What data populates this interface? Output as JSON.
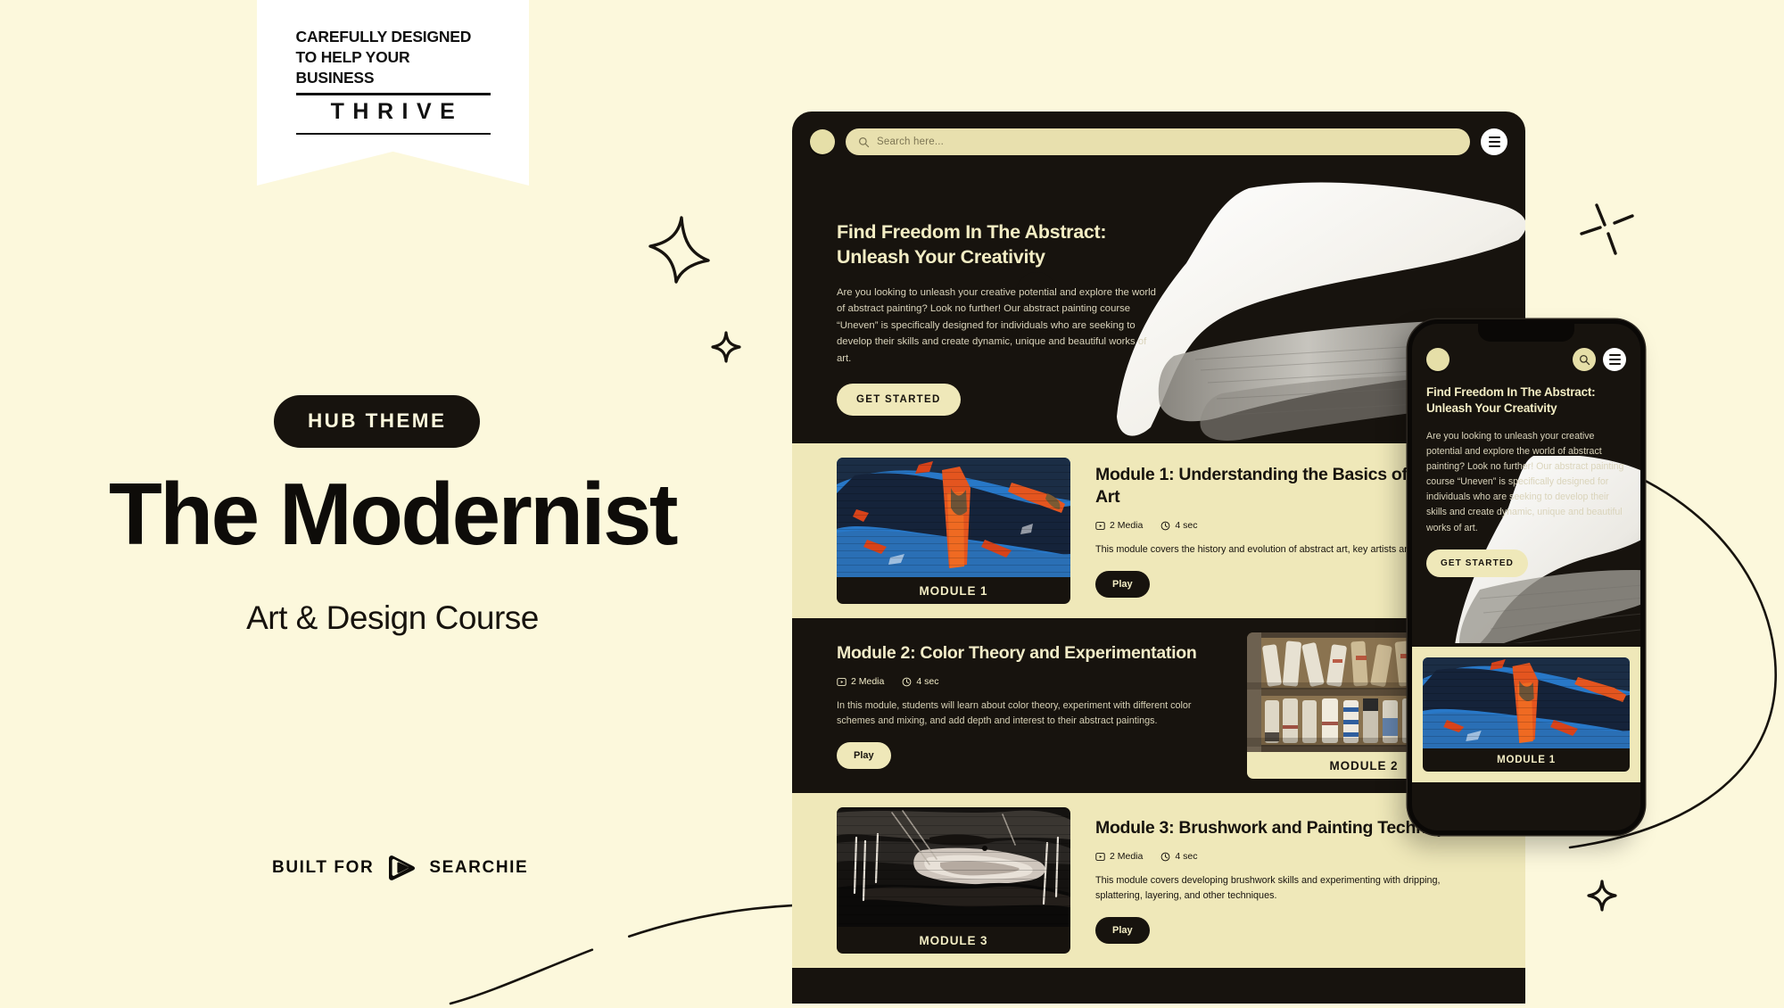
{
  "background_color": "#FCF8DC",
  "ribbon": {
    "line1": "CAREFULLY DESIGNED",
    "line2": "TO HELP YOUR BUSINESS",
    "word": "THRIVE"
  },
  "promo": {
    "badge": "HUB THEME",
    "title": "The Modernist",
    "subtitle": "Art & Design Course",
    "built_for_label": "BUILT FOR",
    "brand": "SEARCHIE",
    "brand_icon": "searchie-play-icon"
  },
  "desktop": {
    "logo_icon": "brand-circle-logo",
    "search": {
      "placeholder": "Search here...",
      "value": "",
      "icon": "search-icon"
    },
    "menu_icon": "hamburger-menu-icon",
    "hero": {
      "title": "Find Freedom In The Abstract: Unleash Your Creativity",
      "title_line1": "Find Freedom In The Abstract:",
      "title_line2": "Unleash Your Creativity",
      "body": "Are you looking to unleash your creative potential and explore the world of abstract painting? Look no further! Our abstract painting course “Uneven” is specifically designed for individuals who are seeking to develop their skills and create dynamic, unique and beautiful works of art.",
      "cta": "GET STARTED",
      "artwork_label": "uneven",
      "artwork_name": "white-brushstroke-artwork"
    },
    "modules": [
      {
        "card_label": "MODULE 1",
        "title": "Module 1: Understanding the Basics of Abstract Art",
        "media_count": "2 Media",
        "duration": "4 sec",
        "media_icon": "media-play-box-icon",
        "clock_icon": "clock-icon",
        "description": "This module covers the history and evolution of abstract art, key artists and techniques.",
        "play_label": "Play",
        "image_name": "blue-orange-abstract-painting",
        "theme": "cream"
      },
      {
        "card_label": "MODULE 2",
        "title": "Module 2: Color Theory and Experimentation",
        "media_count": "2 Media",
        "duration": "4 sec",
        "media_icon": "media-play-box-icon",
        "clock_icon": "clock-icon",
        "description": "In this module, students will learn about color theory, experiment with different color schemes and mixing, and add depth and interest to their abstract paintings.",
        "play_label": "Play",
        "image_name": "vintage-paint-tubes-photo",
        "theme": "dark"
      },
      {
        "card_label": "MODULE 3",
        "title": "Module 3: Brushwork and Painting Techniques",
        "media_count": "2 Media",
        "duration": "4 sec",
        "media_icon": "media-play-box-icon",
        "clock_icon": "clock-icon",
        "description": "This module covers developing brushwork skills and experimenting with dripping, splattering, layering, and other techniques.",
        "play_label": "Play",
        "image_name": "black-white-brushwork-painting",
        "theme": "cream"
      }
    ]
  },
  "phone": {
    "logo_icon": "brand-circle-logo",
    "search_icon": "search-icon",
    "menu_icon": "hamburger-menu-icon",
    "hero": {
      "title_line1": "Find Freedom In The Abstract:",
      "title_line2": "Unleash Your Creativity",
      "body": "Are you looking to unleash your creative potential and explore the world of abstract painting? Look no further! Our abstract painting course “Uneven” is specifically designed for individuals who are seeking to develop their skills and create dynamic, unique and beautiful works of art.",
      "cta": "GET STARTED"
    },
    "module": {
      "card_label": "MODULE 1",
      "image_name": "blue-orange-abstract-painting"
    }
  },
  "decorations": [
    {
      "name": "four-point-star-large"
    },
    {
      "name": "four-point-star-small"
    },
    {
      "name": "sparkle-rays"
    },
    {
      "name": "four-point-star-small-right"
    },
    {
      "name": "curved-line-bottom"
    },
    {
      "name": "curved-line-right"
    }
  ],
  "colors": {
    "page_bg": "#FCF8DC",
    "dark": "#17130E",
    "cream": "#EFE8B9",
    "cream_text": "#F3EDC4",
    "white": "#FFFFFF"
  }
}
